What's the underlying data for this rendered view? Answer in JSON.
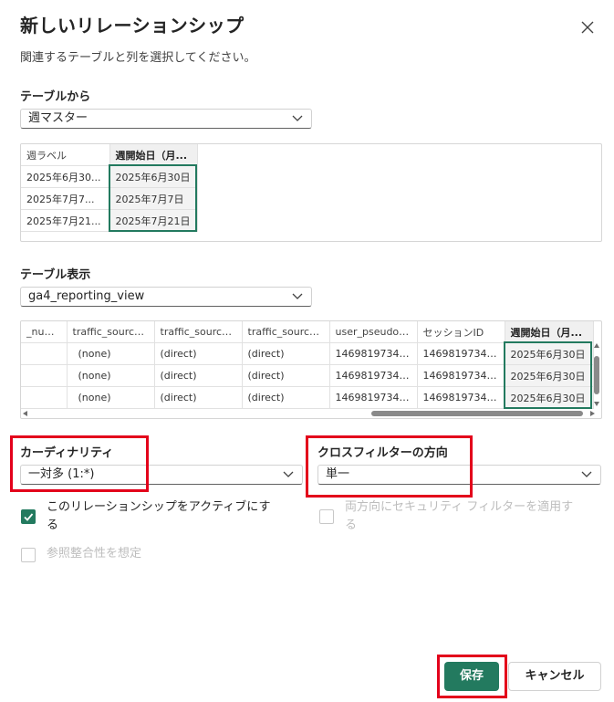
{
  "dialog": {
    "title": "新しいリレーションシップ",
    "subtitle": "関連するテーブルと列を選択してください。"
  },
  "from_table": {
    "label": "テーブルから",
    "selected": "週マスター",
    "columns": [
      "週ラベル",
      "週開始日（月..."
    ],
    "rows": [
      [
        "2025年6月30...",
        "2025年6月30日"
      ],
      [
        "2025年7月7...",
        "2025年7月7日"
      ],
      [
        "2025年7月21...",
        "2025年7月21日"
      ]
    ]
  },
  "to_table": {
    "label": "テーブル表示",
    "selected": "ga4_reporting_view",
    "columns": [
      "_num...",
      "traffic_source...",
      "traffic_source...",
      "traffic_source...",
      "user_pseudo_id",
      "セッションID",
      "週開始日（月..."
    ],
    "rows": [
      [
        "",
        "(none)",
        "(direct)",
        "(direct)",
        "1469819734.1...",
        "1469819734.1...",
        "2025年6月30日"
      ],
      [
        "",
        "(none)",
        "(direct)",
        "(direct)",
        "1469819734.1...",
        "1469819734.1...",
        "2025年6月30日"
      ],
      [
        "",
        "(none)",
        "(direct)",
        "(direct)",
        "1469819734.1...",
        "1469819734.1...",
        "2025年6月30日"
      ]
    ]
  },
  "cardinality": {
    "label": "カーディナリティ",
    "selected": "一対多 (1:*)"
  },
  "cross_filter": {
    "label": "クロスフィルターの方向",
    "selected": "単一"
  },
  "options": {
    "active_label_line1": "このリレーションシップをアクティブにす",
    "active_label_line2": "る",
    "security_label_line1": "両方向にセキュリティ フィルターを適用す",
    "security_label_line2": "る",
    "integrity_label": "参照整合性を想定"
  },
  "buttons": {
    "save": "保存",
    "cancel": "キャンセル"
  },
  "colors": {
    "accent": "#237a5f",
    "highlight": "#e3001b"
  }
}
